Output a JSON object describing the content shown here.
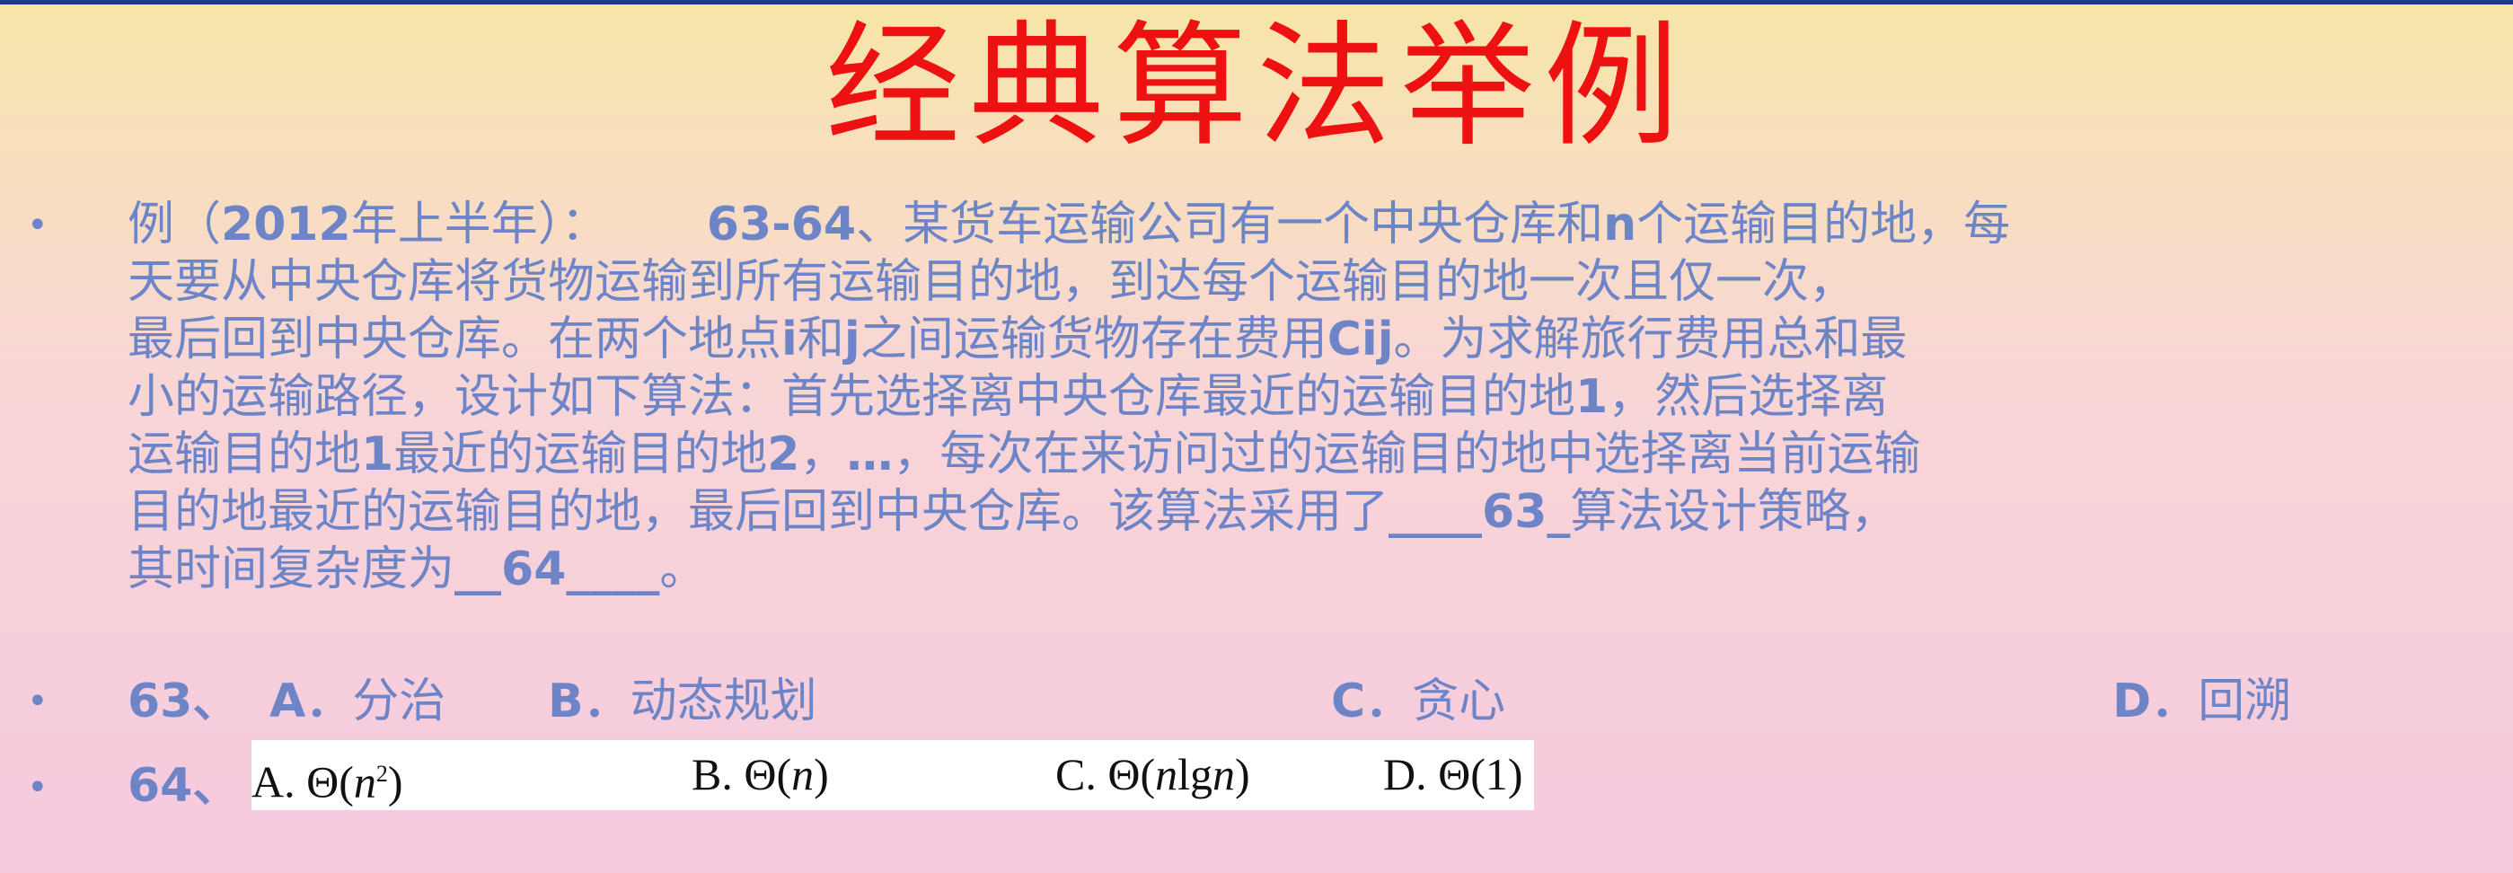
{
  "title": "经典算法举例",
  "bullet_glyph": "•",
  "question": {
    "prefix": "例（",
    "year": "2012",
    "year_suffix": "年上半年）：",
    "number_range": "63-64",
    "line1_rest": "、某货车运输公司有一个中央仓库和",
    "n_letter": "n",
    "line1_tail": "个运输目的地，每",
    "line2": "天要从中央仓库将货物运输到所有运输目的地，到达每个运输目的地一次且仅一次，",
    "line3_a": "最后回到中央仓库。在两个地点",
    "i_letter": "i",
    "line3_b": "和",
    "j_letter": "j",
    "line3_c": "之间运输货物存在费用",
    "cij": "Cij",
    "line3_d": "。为求解旅行费用总和最",
    "line4_a": "小的运输路径，设计如下算法：首先选择离中央仓库最近的运输目的地",
    "line4_num": "1",
    "line4_b": "，然后选择离",
    "line5_a": "运输目的地",
    "line5_num1": "1",
    "line5_b": "最近的运输目的地",
    "line5_num2": "2",
    "line5_c": "，",
    "line5_ellipsis": "…",
    "line5_d": "，每次在来访问过的运输目的地中选择离当前运输",
    "line6_a": "目的地最近的运输目的地，最后回到中央仓库。该算法采用了",
    "blank63": "____63_",
    "line6_b": "算法设计策略，",
    "line7_a": "其时间复杂度为",
    "blank64": "__64____",
    "line7_b": "。"
  },
  "q63": {
    "label": "63、",
    "options": [
      {
        "letter": "A．",
        "text": "分治"
      },
      {
        "letter": "B．",
        "text": "动态规划"
      },
      {
        "letter": "C．",
        "text": "贪心"
      },
      {
        "letter": "D．",
        "text": "回溯"
      }
    ]
  },
  "q64": {
    "label": "64、",
    "options": [
      {
        "letter": "A.",
        "pre": "Θ(",
        "var": "n",
        "sup": "2",
        "post": ")"
      },
      {
        "letter": "B.",
        "pre": "Θ(",
        "var": "n",
        "sup": "",
        "post": ")"
      },
      {
        "letter": "C.",
        "pre": "Θ(",
        "var": "n",
        "sup": "",
        "post": "lg",
        "var2": "n",
        "post2": ")"
      },
      {
        "letter": "D.",
        "pre": "Θ(1)",
        "var": "",
        "sup": "",
        "post": ""
      }
    ]
  },
  "colors": {
    "title": "#ee1111",
    "text": "#6d84c7",
    "rule": "#1f3a8a"
  }
}
